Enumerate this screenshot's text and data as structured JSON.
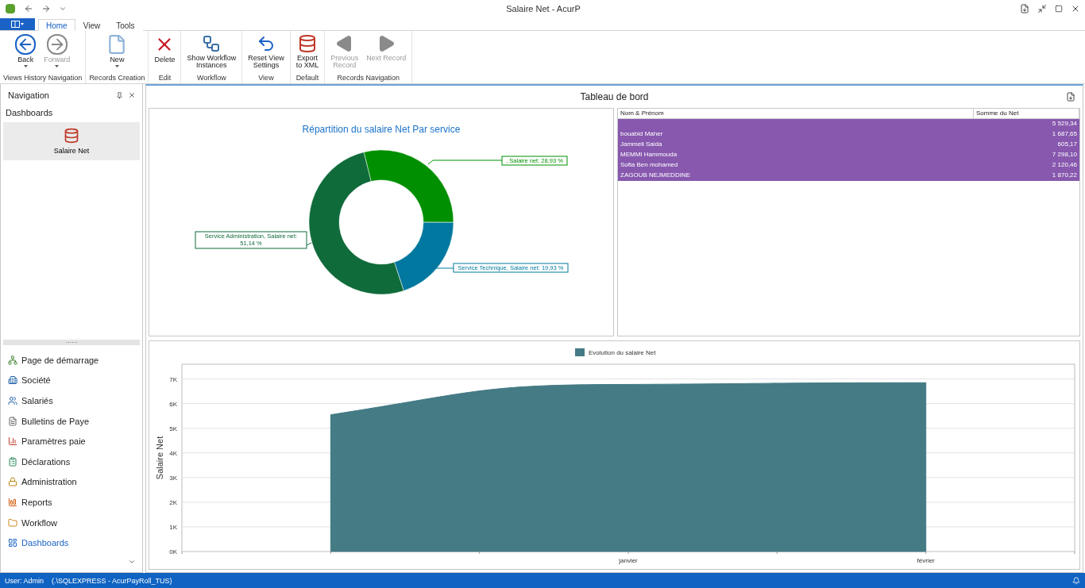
{
  "window": {
    "title": "Salaire Net - AcurP"
  },
  "ribbon": {
    "tabs": [
      {
        "label": "Home",
        "selected": true
      },
      {
        "label": "View",
        "selected": false
      },
      {
        "label": "Tools",
        "selected": false
      }
    ],
    "groups": [
      {
        "label": "Views History Navigation",
        "buttons": [
          {
            "kind": "back",
            "label": "Back",
            "dropdown": true,
            "disabled": false
          },
          {
            "kind": "forward",
            "label": "Forward",
            "dropdown": true,
            "disabled": true
          }
        ]
      },
      {
        "label": "Records Creation",
        "buttons": [
          {
            "kind": "new",
            "label": "New",
            "dropdown": true,
            "disabled": false
          }
        ]
      },
      {
        "label": "Edit",
        "buttons": [
          {
            "kind": "delete",
            "label": "Delete",
            "dropdown": false,
            "disabled": false
          }
        ]
      },
      {
        "label": "Workflow",
        "buttons": [
          {
            "kind": "workflow",
            "label": "Show Workflow\nInstances",
            "dropdown": false,
            "disabled": false
          }
        ]
      },
      {
        "label": "View",
        "buttons": [
          {
            "kind": "reset",
            "label": "Reset View\nSettings",
            "dropdown": false,
            "disabled": false
          }
        ]
      },
      {
        "label": "Default",
        "buttons": [
          {
            "kind": "export",
            "label": "Export\nto XML",
            "dropdown": false,
            "disabled": false
          }
        ]
      },
      {
        "label": "Records Navigation",
        "buttons": [
          {
            "kind": "previous",
            "label": "Previous\nRecord",
            "dropdown": false,
            "disabled": true
          },
          {
            "kind": "next",
            "label": "Next Record",
            "dropdown": false,
            "disabled": true
          }
        ]
      }
    ]
  },
  "navigation": {
    "title": "Navigation",
    "group_title": "Dashboards",
    "tiles": [
      {
        "label": "Salaire Net",
        "selected": true
      }
    ],
    "items": [
      {
        "label": "Page de démarrage",
        "selected": false
      },
      {
        "label": "Société",
        "selected": false
      },
      {
        "label": "Salariés",
        "selected": false
      },
      {
        "label": "Bulletins de Paye",
        "selected": false
      },
      {
        "label": "Paramètres paie",
        "selected": false
      },
      {
        "label": "Déclarations",
        "selected": false
      },
      {
        "label": "Administration",
        "selected": false
      },
      {
        "label": "Reports",
        "selected": false
      },
      {
        "label": "Workflow",
        "selected": false
      },
      {
        "label": "Dashboards",
        "selected": true
      }
    ]
  },
  "dashboard": {
    "title": "Tableau de bord",
    "donut": {
      "chart_data": {
        "type": "donut",
        "title": "Répartition du salaire Net Par service",
        "values": [
          28.93,
          19.93,
          51.14
        ],
        "value_labels": [
          ", Salaire net: 28,93 %",
          "Service Technique, Salaire net: 19,93 %",
          "Service Administration, Salaire net:\n51,14 %"
        ]
      }
    },
    "grid": {
      "columns": [
        "Nom & Prénom",
        "Somme du Net"
      ],
      "rows": [
        {
          "cells": [
            "",
            "5 529,34"
          ],
          "selected": true
        },
        {
          "cells": [
            "bouabid Maher",
            "1 687,65"
          ],
          "selected": true
        },
        {
          "cells": [
            "Jammeli Saida",
            "605,17"
          ],
          "selected": true
        },
        {
          "cells": [
            "MEMMI Hammouda",
            "7 298,10"
          ],
          "selected": true
        },
        {
          "cells": [
            "Sofia Ben mohamed",
            "2 120,46"
          ],
          "selected": true
        },
        {
          "cells": [
            "ZAGOUB NEJMEDDINE",
            "1 870,22"
          ],
          "selected": true
        }
      ]
    },
    "area": {
      "chart_data": {
        "type": "area",
        "ylabel": "Salaire Net",
        "categories": [
          null,
          "janvier",
          "février"
        ],
        "series": [
          {
            "name": "Evolution du salaire Net",
            "color": "#447b84",
            "values": [
              5550,
              6780,
              6850
            ]
          }
        ],
        "ylim": [
          0,
          7600
        ],
        "grid": true,
        "yticks": [
          {
            "value": 0,
            "label": "0K"
          },
          {
            "value": 1000,
            "label": "1K"
          },
          {
            "value": 2000,
            "label": "2K"
          },
          {
            "value": 3000,
            "label": "3K"
          },
          {
            "value": 4000,
            "label": "4K"
          },
          {
            "value": 5000,
            "label": "5K"
          },
          {
            "value": 6000,
            "label": "6K"
          },
          {
            "value": 7000,
            "label": "7K"
          }
        ]
      }
    }
  },
  "status_bar": {
    "user": "User: Admin",
    "connection": "(.\\SQLEXPRESS - AcurPayRoll_TUS)"
  }
}
